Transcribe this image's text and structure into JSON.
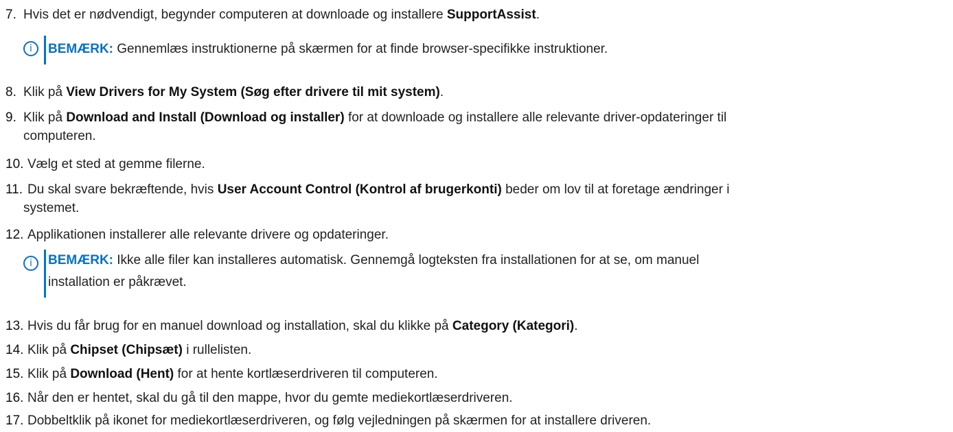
{
  "steps": [
    {
      "num": "7.",
      "pre": "Hvis det er nødvendigt, begynder computeren at downloade og installere ",
      "bold": "SupportAssist",
      "post": "."
    },
    {
      "num": "8.",
      "pre": "Klik på ",
      "bold": "View Drivers for My System (Søg efter drivere til mit system)",
      "post": "."
    },
    {
      "num": "9.",
      "pre": "Klik på ",
      "bold": "Download and Install (Download og installer)",
      "post": " for at downloade og installere alle relevante driver-opdateringer til",
      "cont": "computeren."
    },
    {
      "num": "10.",
      "pre": "Vælg et sted at gemme filerne.",
      "bold": "",
      "post": ""
    },
    {
      "num": "11.",
      "pre": "Du skal svare bekræftende, hvis ",
      "bold": "User Account Control (Kontrol af brugerkonti)",
      "post": " beder om lov til at foretage ændringer i",
      "cont": "systemet."
    },
    {
      "num": "12.",
      "pre": "Applikationen installerer alle relevante drivere og opdateringer.",
      "bold": "",
      "post": ""
    },
    {
      "num": "13.",
      "pre": "Hvis du får brug for en manuel download og installation, skal du klikke på ",
      "bold": "Category (Kategori)",
      "post": "."
    },
    {
      "num": "14.",
      "pre": "Klik på ",
      "bold": "Chipset (Chipsæt)",
      "post": " i rullelisten."
    },
    {
      "num": "15.",
      "pre": "Klik på ",
      "bold": "Download (Hent)",
      "post": " for at hente kortlæserdriveren til computeren."
    },
    {
      "num": "16.",
      "pre": "Når den er hentet, skal du gå til den mappe, hvor du gemte mediekortlæserdriveren.",
      "bold": "",
      "post": ""
    },
    {
      "num": "17.",
      "pre": "Dobbeltklik på ikonet for mediekortlæserdriveren, og følg vejledningen på skærmen for at installere driveren.",
      "bold": "",
      "post": ""
    }
  ],
  "notes": [
    {
      "icon": "info-icon",
      "label": "BEMÆRK:",
      "line1": " Gennemlæs instruktionerne på skærmen for at finde browser-specifikke instruktioner.",
      "line2": ""
    },
    {
      "icon": "info-icon",
      "label": "BEMÆRK:",
      "line1": " Ikke alle filer kan installeres automatisk. Gennemgå logteksten fra installationen for at se, om manuel",
      "line2": "installation er påkrævet."
    }
  ],
  "colors": {
    "accent": "#0672cb",
    "text": "#222222"
  }
}
